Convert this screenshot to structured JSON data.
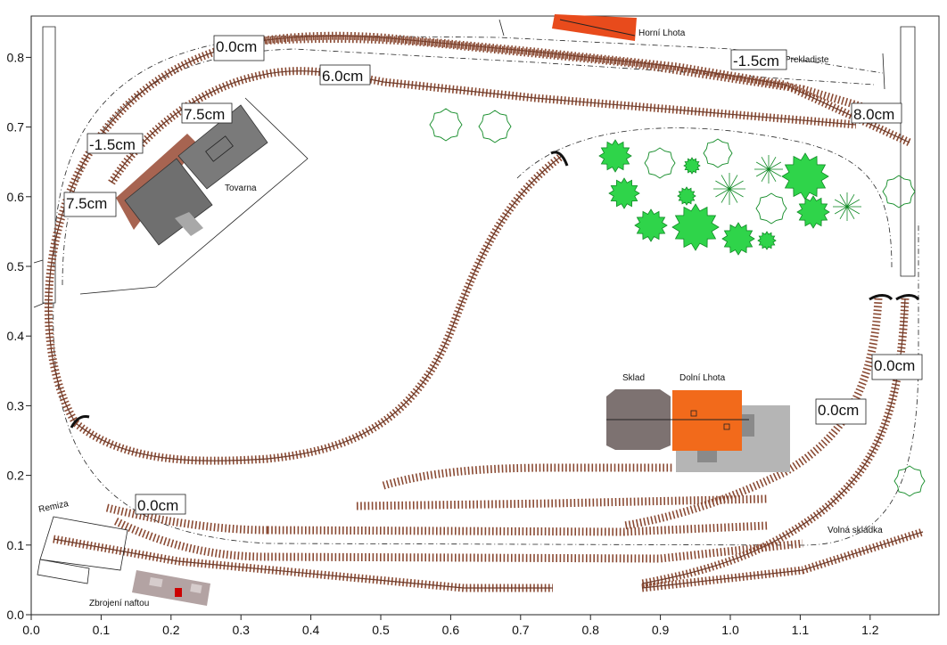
{
  "axes": {
    "x_ticks": [
      "0.0",
      "0.1",
      "0.2",
      "0.3",
      "0.4",
      "0.5",
      "0.6",
      "0.7",
      "0.8",
      "0.9",
      "1.0",
      "1.1",
      "1.2"
    ],
    "y_ticks": [
      "0.0",
      "0.1",
      "0.2",
      "0.3",
      "0.4",
      "0.5",
      "0.6",
      "0.7",
      "0.8"
    ]
  },
  "height_labels": [
    {
      "id": "h1",
      "text": "0.0cm"
    },
    {
      "id": "h2",
      "text": "6.0cm"
    },
    {
      "id": "h3",
      "text": "7.5cm"
    },
    {
      "id": "h4",
      "text": "-1.5cm"
    },
    {
      "id": "h5",
      "text": "7.5cm"
    },
    {
      "id": "h6",
      "text": "-1.5cm"
    },
    {
      "id": "h7",
      "text": "8.0cm"
    },
    {
      "id": "h8",
      "text": "0.0cm"
    },
    {
      "id": "h9",
      "text": "0.0cm"
    },
    {
      "id": "h10",
      "text": "0.0cm"
    }
  ],
  "places": {
    "horni_lhota": "Horní Lhota",
    "prekladiste": "Prekladiste",
    "tovarna": "Tovarna",
    "sklad": "Sklad",
    "dolni_lhota": "Dolní Lhota",
    "remiza": "Remiza",
    "zbrojeni_naftou": "Zbrojení naftou",
    "volna_skladka": "Volná skládka"
  },
  "colors": {
    "track": "#8a4a33",
    "factory_roof": "#6f6f6f",
    "factory_brick": "#a76451",
    "station_orange": "#f26a1b",
    "sklad_grey": "#7d7271",
    "platform_grey": "#b5b5b5",
    "tree_green": "#2fd44a",
    "horni_lhota_red": "#e84b1c",
    "fuel_red": "#cc0000"
  }
}
